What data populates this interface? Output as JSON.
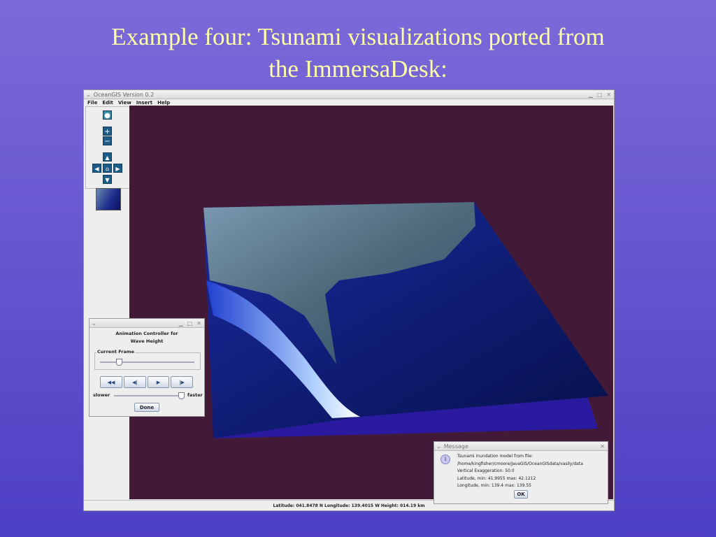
{
  "slide": {
    "title_line1": "Example four: Tsunami visualizations ported from",
    "title_line2": "the ImmersaDesk:"
  },
  "app": {
    "title": "OceanGIS Version 0.2",
    "menu": [
      "File",
      "Edit",
      "View",
      "Insert",
      "Help"
    ],
    "status": "Latitude: 041.8478 N Longitude: 139.4015 W Height: 014.19 km",
    "viewport_color": "#421a38"
  },
  "anim": {
    "title_line1": "Animation Controller for",
    "title_line2": "Wave Height",
    "frame_label": "Current Frame",
    "frame_value": 0.2,
    "slower": "slower",
    "faster": "faster",
    "speed_value": 0.98,
    "done": "Done"
  },
  "message": {
    "title": "Message",
    "lines": [
      "Tsunami inundation model from file:",
      "/home/kingfisher/cmoore/JavaGIS/OceanGISdata/vasily/data",
      "Vertical Exaggeration: 50.0",
      "Latitude, min: 41.9955 max: 42.1212",
      "Longitude, min: 139.4 max: 139.55"
    ],
    "ok": "OK"
  }
}
